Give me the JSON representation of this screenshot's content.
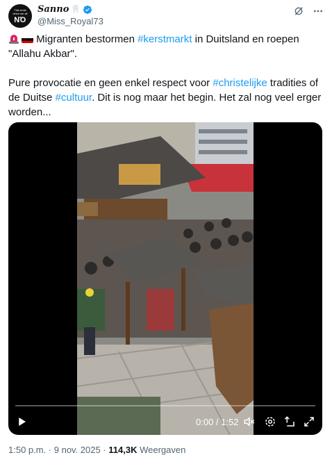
{
  "author": {
    "avatar_small_text": "This ends when we all say",
    "avatar_big_text": "NO",
    "display_name": "Sanno",
    "handle": "@Miss_Royal73"
  },
  "tweet": {
    "line1_text_a": "Migranten bestormen ",
    "hashtag_kerstmarkt": "#kerstmarkt",
    "line1_text_b": " in Duitsland en roepen \"Allahu Akbar\".",
    "line2_text_a": "Pure provocatie en geen enkel respect voor ",
    "hashtag_christelijke": "#christelijke",
    "line2_text_b": " tradities of de Duitse ",
    "hashtag_cultuur": "#cultuur",
    "line2_text_c": ". Dit is nog maar het begin. Het zal nog veel erger worden..."
  },
  "video": {
    "time": "0:00 / 1:52",
    "progress": 0
  },
  "meta": {
    "time": "1:50 p.m. · 9 nov. 2025 · ",
    "views": "114,3K",
    "views_label": " Weergaven"
  }
}
